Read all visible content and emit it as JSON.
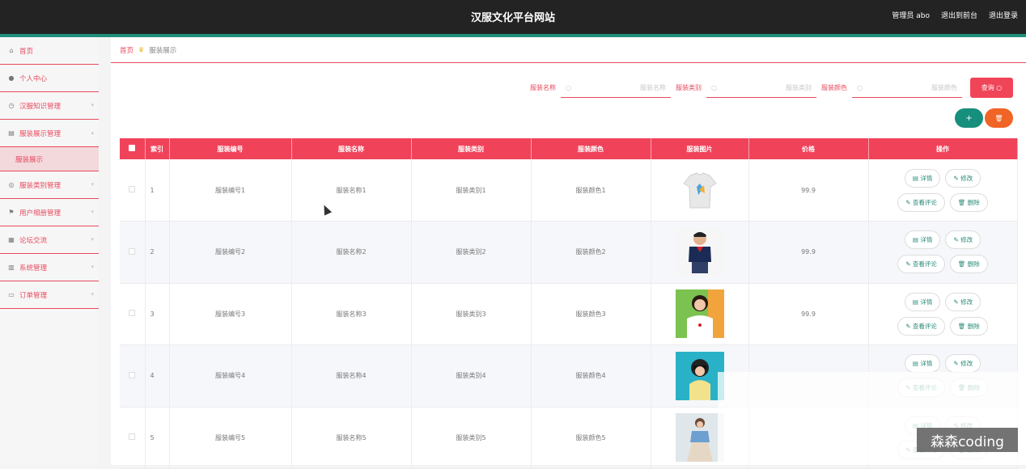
{
  "header": {
    "title": "汉服文化平台网站",
    "admin": "管理员 abo",
    "to_front": "退出到前台",
    "logout": "退出登录"
  },
  "sidebar": {
    "items": [
      {
        "label": "首页",
        "icon": "home-icon"
      },
      {
        "label": "个人中心",
        "icon": "user-icon"
      },
      {
        "label": "汉服知识管理",
        "icon": "clock-icon"
      },
      {
        "label": "服装展示管理",
        "icon": "doc-icon"
      },
      {
        "label": "服装类别管理",
        "icon": "compass-icon"
      },
      {
        "label": "用户相册管理",
        "icon": "flag-icon"
      },
      {
        "label": "论坛交流",
        "icon": "grid-icon"
      },
      {
        "label": "系统管理",
        "icon": "building-icon"
      },
      {
        "label": "订单管理",
        "icon": "list-icon"
      }
    ],
    "sub": "服装展示"
  },
  "breadcrumb": {
    "home": "首页",
    "current": "服装展示"
  },
  "search": {
    "name_label": "服装名称",
    "name_placeholder": "服装名称",
    "type_label": "服装类别",
    "type_placeholder": "服装类别",
    "color_label": "服装颜色",
    "color_placeholder": "服装颜色",
    "button": "查询"
  },
  "table": {
    "headers": [
      "索引",
      "服装编号",
      "服装名称",
      "服装类别",
      "服装颜色",
      "服装图片",
      "价格",
      "操作"
    ],
    "rows": [
      {
        "idx": "1",
        "code": "服装编号1",
        "name": "服装名称1",
        "type": "服装类别1",
        "color": "服装颜色1",
        "price": "99.9"
      },
      {
        "idx": "2",
        "code": "服装编号2",
        "name": "服装名称2",
        "type": "服装类别2",
        "color": "服装颜色2",
        "price": "99.9"
      },
      {
        "idx": "3",
        "code": "服装编号3",
        "name": "服装名称3",
        "type": "服装类别3",
        "color": "服装颜色3",
        "price": "99.9"
      },
      {
        "idx": "4",
        "code": "服装编号4",
        "name": "服装名称4",
        "type": "服装类别4",
        "color": "服装颜色4",
        "price": ""
      },
      {
        "idx": "5",
        "code": "服装编号5",
        "name": "服装名称5",
        "type": "服装类别5",
        "color": "服装颜色5",
        "price": ""
      }
    ],
    "ops": {
      "detail": "详情",
      "edit": "修改",
      "comments": "查看评论",
      "delete": "删除"
    }
  },
  "watermark": "森森coding",
  "colors": {
    "accent": "#f0435a",
    "green": "#168f7d",
    "orange": "#f06425"
  }
}
